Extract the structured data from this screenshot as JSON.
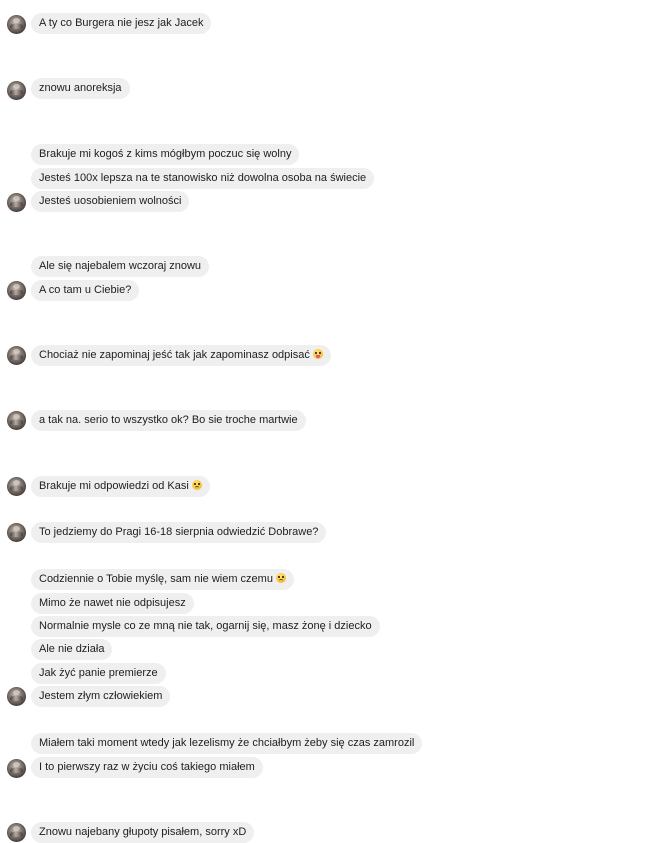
{
  "messages": [
    {
      "text": "A ty co Burgera nie jesz jak Jacek"
    },
    {
      "text": "znowu anoreksja"
    },
    {
      "text": "Brakuje mi kogoś z kims mógłbym poczuc się wolny"
    },
    {
      "text": "Jesteś 100x lepsza na te stanowisko niż dowolna osoba na świecie"
    },
    {
      "text": "Jesteś uosobieniem wolności"
    },
    {
      "text": "Ale się najebalem wczoraj znowu"
    },
    {
      "text": "A co tam u Ciebie?"
    },
    {
      "text": "Chociaż nie zapominaj jeść tak jak zapominasz odpisać",
      "emoji": "face-with-tongue-icon"
    },
    {
      "text": "a tak na. serio to wszystko ok? Bo sie troche martwie"
    },
    {
      "text": "Brakuje mi odpowiedzi od Kasi",
      "emoji": "disappointed-face-icon"
    },
    {
      "text": "To jedziemy do Pragi 16-18 sierpnia odwiedzić Dobrawe?"
    },
    {
      "text": "Codziennie o Tobie myślę, sam nie wiem czemu",
      "emoji": "disappointed-face-icon"
    },
    {
      "text": "Mimo że nawet nie odpisujesz"
    },
    {
      "text": "Normalnie mysle co ze mną nie tak, ogarnij się, masz żonę i dziecko"
    },
    {
      "text": "Ale nie działa"
    },
    {
      "text": "Jak żyć panie premierze"
    },
    {
      "text": "Jestem złym człowiekiem"
    },
    {
      "text": "Miałem taki moment wtedy jak lezelismy że chciałbym żeby się czas zamrozil"
    },
    {
      "text": "I to pierwszy raz w życiu coś takiego miałem"
    },
    {
      "text": "Znowu najebany głupoty pisałem, sorry xD"
    }
  ]
}
